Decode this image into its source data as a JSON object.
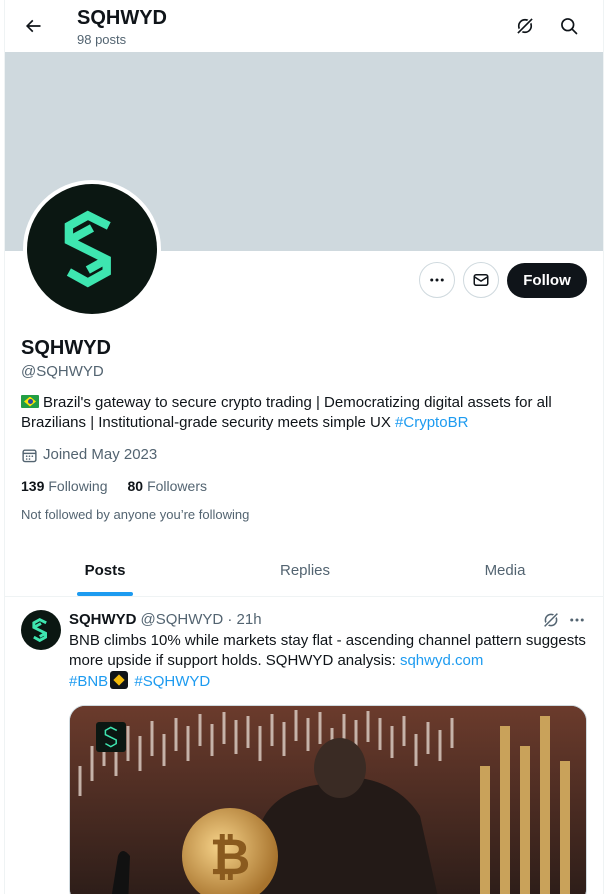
{
  "header": {
    "title": "SQHWYD",
    "post_count": "98 posts"
  },
  "profile": {
    "name": "SQHWYD",
    "handle": "@SQHWYD",
    "bio_text": "Brazil's gateway to secure crypto trading | Democratizing digital assets for all Brazilians | Institutional-grade security meets simple UX ",
    "bio_hashtag": "#CryptoBR",
    "joined": "Joined May 2023",
    "following_count": "139",
    "following_label": "Following",
    "followers_count": "80",
    "followers_label": "Followers",
    "not_followed": "Not followed by anyone you’re following",
    "follow_label": "Follow"
  },
  "tabs": [
    {
      "label": "Posts",
      "active": true
    },
    {
      "label": "Replies",
      "active": false
    },
    {
      "label": "Media",
      "active": false
    }
  ],
  "post": {
    "name": "SQHWYD",
    "meta": "@SQHWYD · 21h",
    "text": "BNB climbs 10% while markets stay flat - ascending channel pattern suggests more upside if support holds. SQHWYD analysis: ",
    "link": "sqhwyd.com",
    "hashtag1": "#BNB",
    "hashtag2": "#SQHWYD"
  },
  "colors": {
    "accent": "#1d9bf0",
    "brand_green": "#3ee6b0",
    "banner": "#cfd9de",
    "text": "#0f1419",
    "muted": "#536471"
  },
  "icons": [
    "back-arrow-icon",
    "grok-icon",
    "search-icon",
    "more-icon",
    "message-icon",
    "calendar-icon",
    "brand-logo-icon",
    "flag-brazil-icon",
    "bnb-icon"
  ]
}
